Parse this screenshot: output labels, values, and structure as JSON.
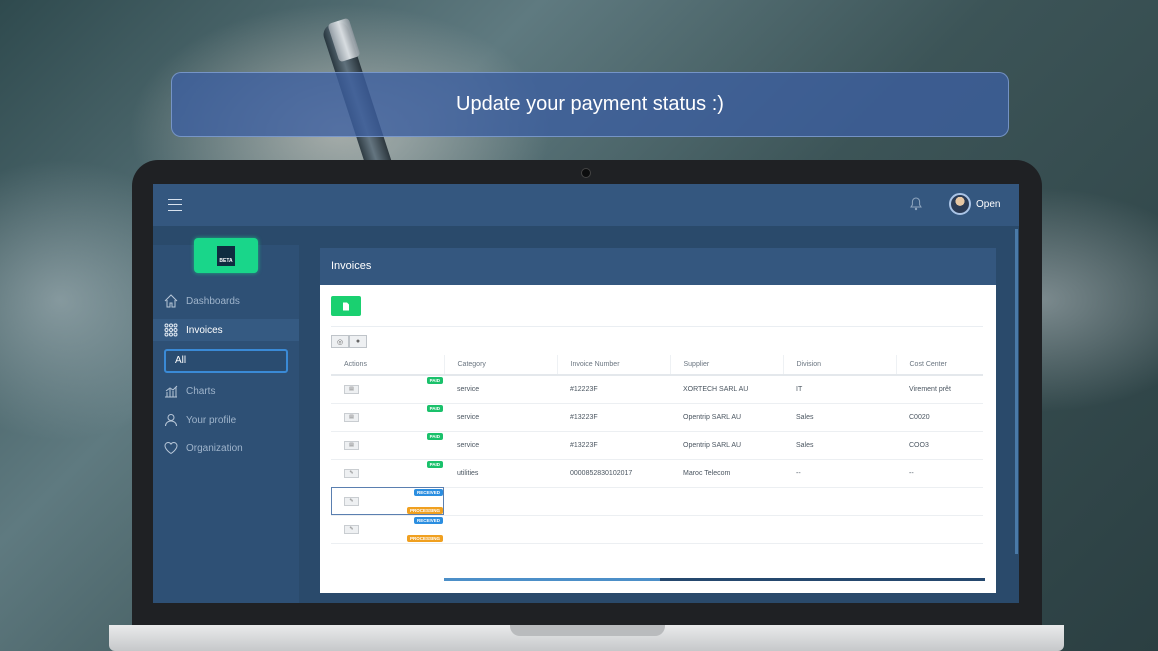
{
  "banner": {
    "text": "Update your payment status :)"
  },
  "topbar": {
    "user_label": "Open",
    "bell_icon": "bell-icon",
    "menu_icon": "hamburger-icon"
  },
  "sidebar": {
    "logo_text": "BETA",
    "items": [
      {
        "label": "Dashboards",
        "icon": "home-icon"
      },
      {
        "label": "Invoices",
        "icon": "grid-icon"
      },
      {
        "label": "All",
        "icon": ""
      },
      {
        "label": "Charts",
        "icon": "chart-icon"
      },
      {
        "label": "Your profile",
        "icon": "user-icon"
      },
      {
        "label": "Organization",
        "icon": "heart-icon"
      }
    ]
  },
  "invoices": {
    "title": "Invoices",
    "columns": [
      "Actions",
      "Category",
      "Invoice Number",
      "Supplier",
      "Division",
      "Cost Center"
    ],
    "rows": [
      {
        "badges": [
          "PAID"
        ],
        "category": "service",
        "number": "#12223F",
        "supplier": "XORTECH SARL AU",
        "division": "IT",
        "cost_center": "Virement prêt"
      },
      {
        "badges": [
          "PAID"
        ],
        "category": "service",
        "number": "#13223F",
        "supplier": "Opentrip SARL AU",
        "division": "Sales",
        "cost_center": "C0020"
      },
      {
        "badges": [
          "PAID"
        ],
        "category": "service",
        "number": "#13223F",
        "supplier": "Opentrip SARL AU",
        "division": "Sales",
        "cost_center": "COO3"
      },
      {
        "badges": [
          "PAID"
        ],
        "category": "utilities",
        "number": "0000852830102017",
        "supplier": "Maroc Telecom",
        "division": "--",
        "cost_center": "--"
      },
      {
        "badges": [
          "RECEIVED",
          "PROCESSING"
        ],
        "category": "",
        "number": "",
        "supplier": "",
        "division": "",
        "cost_center": ""
      },
      {
        "badges": [
          "RECEIVED",
          "PROCESSING"
        ],
        "category": "",
        "number": "",
        "supplier": "",
        "division": "",
        "cost_center": ""
      }
    ]
  },
  "colors": {
    "paid": "#1ac16b",
    "received": "#2b8ee0",
    "processing": "#f0a020",
    "accent": "#19d68a"
  }
}
